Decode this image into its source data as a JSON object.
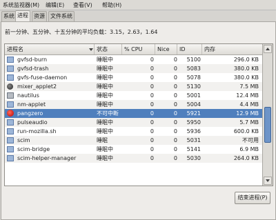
{
  "menubar": [
    {
      "label": "系统监视器(M)"
    },
    {
      "label": "编辑(E)"
    },
    {
      "label": "查看(V)"
    },
    {
      "label": "帮助(H)"
    }
  ],
  "tabs": [
    {
      "label": "系统",
      "active": false
    },
    {
      "label": "进程",
      "active": true
    },
    {
      "label": "资源",
      "active": false
    },
    {
      "label": "文件系统",
      "active": false
    }
  ],
  "load_avg": "前一分钟、五分钟、十五分钟的平均负载：3.15，2.63，1.64",
  "columns": {
    "name": "进程名",
    "status": "状态",
    "cpu": "% CPU",
    "nice": "Nice",
    "id": "ID",
    "mem": "内存"
  },
  "processes": [
    {
      "name": "gvfsd-burn",
      "status": "睡眠中",
      "cpu": "0",
      "nice": "0",
      "id": "5100",
      "mem": "296.0 KB",
      "icon": "blue",
      "selected": false
    },
    {
      "name": "gvfsd-trash",
      "status": "睡眠中",
      "cpu": "0",
      "nice": "0",
      "id": "5083",
      "mem": "380.0 KB",
      "icon": "blue",
      "selected": false
    },
    {
      "name": "gvfs-fuse-daemon",
      "status": "睡眠中",
      "cpu": "0",
      "nice": "0",
      "id": "5078",
      "mem": "380.0 KB",
      "icon": "blue",
      "selected": false
    },
    {
      "name": "mixer_applet2",
      "status": "睡眠中",
      "cpu": "0",
      "nice": "0",
      "id": "5130",
      "mem": "7.5 MB",
      "icon": "dark",
      "selected": false
    },
    {
      "name": "nautilus",
      "status": "睡眠中",
      "cpu": "0",
      "nice": "0",
      "id": "5001",
      "mem": "12.4 MB",
      "icon": "grey",
      "selected": false
    },
    {
      "name": "nm-applet",
      "status": "睡眠中",
      "cpu": "0",
      "nice": "0",
      "id": "5004",
      "mem": "4.4 MB",
      "icon": "blue",
      "selected": false
    },
    {
      "name": "pangzero",
      "status": "不可中断",
      "cpu": "0",
      "nice": "0",
      "id": "5921",
      "mem": "12.9 MB",
      "icon": "red",
      "selected": true
    },
    {
      "name": "pulseaudio",
      "status": "睡眠中",
      "cpu": "0",
      "nice": "0",
      "id": "5950",
      "mem": "5.7 MB",
      "icon": "blue",
      "selected": false
    },
    {
      "name": "run-mozilla.sh",
      "status": "睡眠中",
      "cpu": "0",
      "nice": "0",
      "id": "5936",
      "mem": "600.0 KB",
      "icon": "blue",
      "selected": false
    },
    {
      "name": "scim",
      "status": "睡眠",
      "cpu": "0",
      "nice": "0",
      "id": "5031",
      "mem": "不可用",
      "icon": "blue",
      "selected": false
    },
    {
      "name": "scim-bridge",
      "status": "睡眠中",
      "cpu": "0",
      "nice": "0",
      "id": "5141",
      "mem": "6.9 MB",
      "icon": "blue",
      "selected": false
    },
    {
      "name": "scim-helper-manager",
      "status": "睡眠中",
      "cpu": "0",
      "nice": "0",
      "id": "5030",
      "mem": "264.0 KB",
      "icon": "blue",
      "selected": false
    }
  ],
  "scroll_position": 0.62,
  "end_button": "结束进程(P)",
  "colors": {
    "selection": "#4f7fbd",
    "scroll_thumb": "#6d94c8",
    "window_bg": "#d6d4d0"
  }
}
